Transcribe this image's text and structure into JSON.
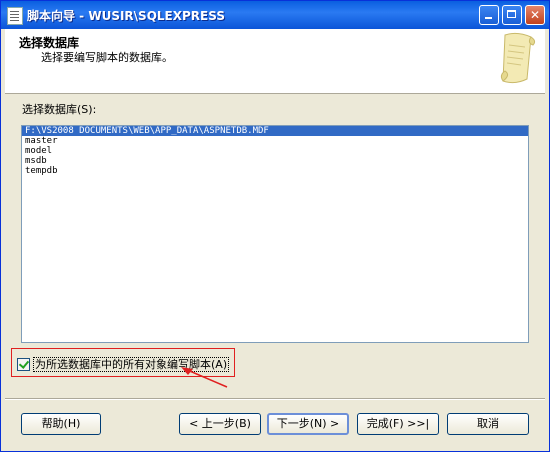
{
  "window": {
    "title": "脚本向导 - WUSIR\\SQLEXPRESS"
  },
  "header": {
    "title": "选择数据库",
    "subtitle": "选择要编写脚本的数据库。"
  },
  "main": {
    "list_label": "选择数据库(S):",
    "databases": [
      "F:\\VS2008 DOCUMENTS\\WEB\\APP_DATA\\ASPNETDB.MDF",
      "master",
      "model",
      "msdb",
      "tempdb"
    ],
    "selected_index": 0,
    "script_all_objects": {
      "label": "为所选数据库中的所有对象编写脚本(A)",
      "checked": true
    }
  },
  "footer": {
    "help": "帮助(H)",
    "back": "< 上一步(B)",
    "next": "下一步(N) >",
    "finish": "完成(F) >>|",
    "cancel": "取消"
  },
  "colors": {
    "selection": "#316ac5",
    "annotation": "#e02020"
  }
}
